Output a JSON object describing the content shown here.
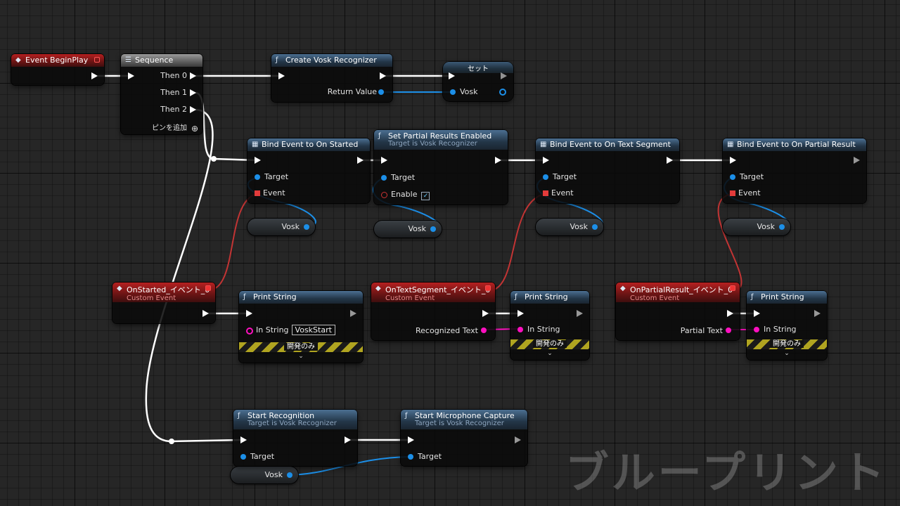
{
  "watermark": "ブループリント",
  "colors": {
    "exec": "#ffffff",
    "object": "#1c8fe8",
    "string": "#ff10c0",
    "delegate": "#e23b3b"
  },
  "nodes": {
    "begin_play": {
      "title": "Event BeginPlay"
    },
    "sequence": {
      "title": "Sequence",
      "then0": "Then 0",
      "then1": "Then 1",
      "then2": "Then 2",
      "add_pin": "ピンを追加"
    },
    "create_vosk": {
      "title": "Create Vosk Recognizer",
      "return_value": "Return Value"
    },
    "set_vosk": {
      "title": "セット",
      "var": "Vosk"
    },
    "bind_started": {
      "title": "Bind Event to On Started",
      "target": "Target",
      "event": "Event"
    },
    "set_partial": {
      "title": "Set Partial Results Enabled",
      "subtitle": "Target is Vosk Recognizer",
      "target": "Target",
      "enable": "Enable",
      "enable_checked": "✓"
    },
    "bind_text": {
      "title": "Bind Event to On Text Segment",
      "target": "Target",
      "event": "Event"
    },
    "bind_partial": {
      "title": "Bind Event to On Partial Result",
      "target": "Target",
      "event": "Event"
    },
    "on_started": {
      "title": "OnStarted_イベント_0",
      "subtitle": "Custom Event"
    },
    "print1": {
      "title": "Print String",
      "in_string": "In String",
      "value": "VoskStart",
      "dev": "開発のみ"
    },
    "on_text": {
      "title": "OnTextSegment_イベント_0",
      "subtitle": "Custom Event",
      "output": "Recognized Text"
    },
    "print2": {
      "title": "Print String",
      "in_string": "In String",
      "dev": "開発のみ"
    },
    "on_partial": {
      "title": "OnPartialResult_イベント_0",
      "subtitle": "Custom Event",
      "output": "Partial Text"
    },
    "print3": {
      "title": "Print String",
      "in_string": "In String",
      "dev": "開発のみ"
    },
    "start_rec": {
      "title": "Start Recognition",
      "subtitle": "Target is Vosk Recognizer",
      "target": "Target"
    },
    "start_mic": {
      "title": "Start Microphone Capture",
      "subtitle": "Target is Vosk Recognizer",
      "target": "Target"
    }
  },
  "vars": {
    "v1": "Vosk",
    "v2": "Vosk",
    "v3": "Vosk",
    "v4": "Vosk",
    "v5": "Vosk"
  }
}
